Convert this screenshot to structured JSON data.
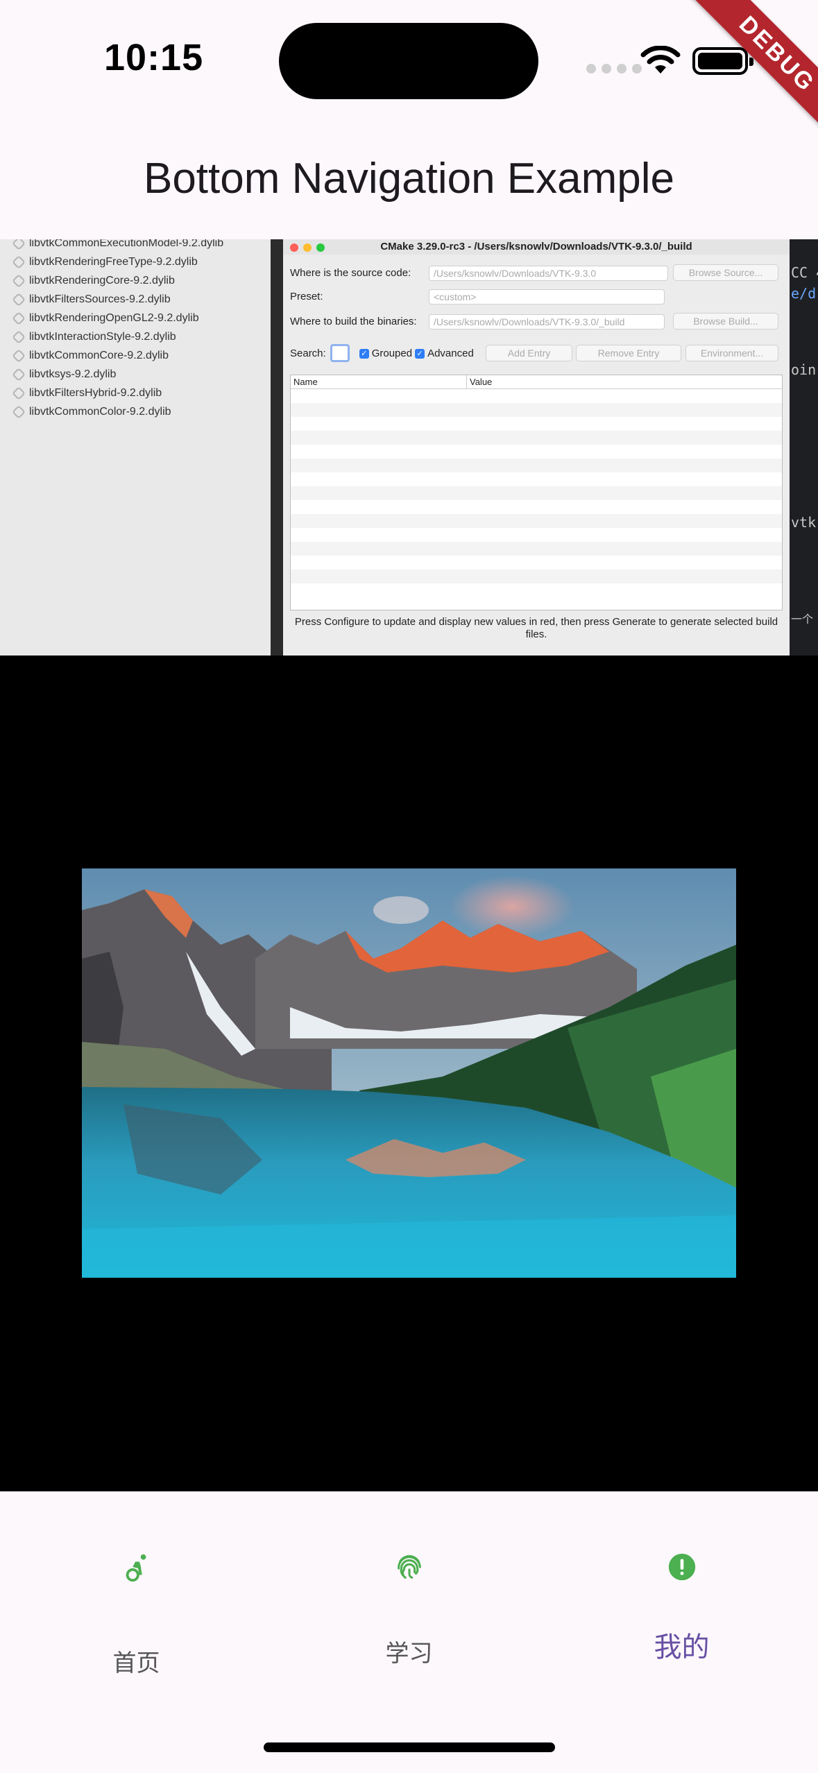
{
  "status_bar": {
    "time": "10:15"
  },
  "debug_banner": "DEBUG",
  "app_bar": {
    "title": "Bottom Navigation Example"
  },
  "screenshot": {
    "finder_files": [
      "libvtkCommonExecutionModel-9.2.dylib",
      "libvtkRenderingFreeType-9.2.dylib",
      "libvtkRenderingCore-9.2.dylib",
      "libvtkFiltersSources-9.2.dylib",
      "libvtkRenderingOpenGL2-9.2.dylib",
      "libvtkInteractionStyle-9.2.dylib",
      "libvtkCommonCore-9.2.dylib",
      "libvtksys-9.2.dylib",
      "libvtkFiltersHybrid-9.2.dylib",
      "libvtkCommonColor-9.2.dylib"
    ],
    "cmake": {
      "title": "CMake 3.29.0-rc3 - /Users/ksnowlv/Downloads/VTK-9.3.0/_build",
      "source_label": "Where is the source code:",
      "source_value": "/Users/ksnowlv/Downloads/VTK-9.3.0",
      "browse_source": "Browse Source...",
      "preset_label": "Preset:",
      "preset_value": "<custom>",
      "build_label": "Where to build the binaries:",
      "build_value": "/Users/ksnowlv/Downloads/VTK-9.3.0/_build",
      "browse_build": "Browse Build...",
      "search_label": "Search:",
      "grouped_label": "Grouped",
      "advanced_label": "Advanced",
      "add_entry": "Add Entry",
      "remove_entry": "Remove Entry",
      "environment": "Environment...",
      "col_name": "Name",
      "col_value": "Value",
      "note": "Press Configure to update and display new values in red, then press Generate to generate selected build files."
    },
    "editor_fragments": [
      "CC 4",
      "e/d",
      "oin",
      "vtk",
      "一个"
    ]
  },
  "bottom_nav": {
    "items": [
      {
        "label": "首页",
        "icon": "accessible-forward-icon",
        "color": "#4caf50"
      },
      {
        "label": "学习",
        "icon": "fingerprint-icon",
        "color": "#4caf50"
      },
      {
        "label": "我的",
        "icon": "error-icon",
        "color": "#4caf50",
        "selected": true
      }
    ],
    "selected_label_color": "#6750a4"
  }
}
